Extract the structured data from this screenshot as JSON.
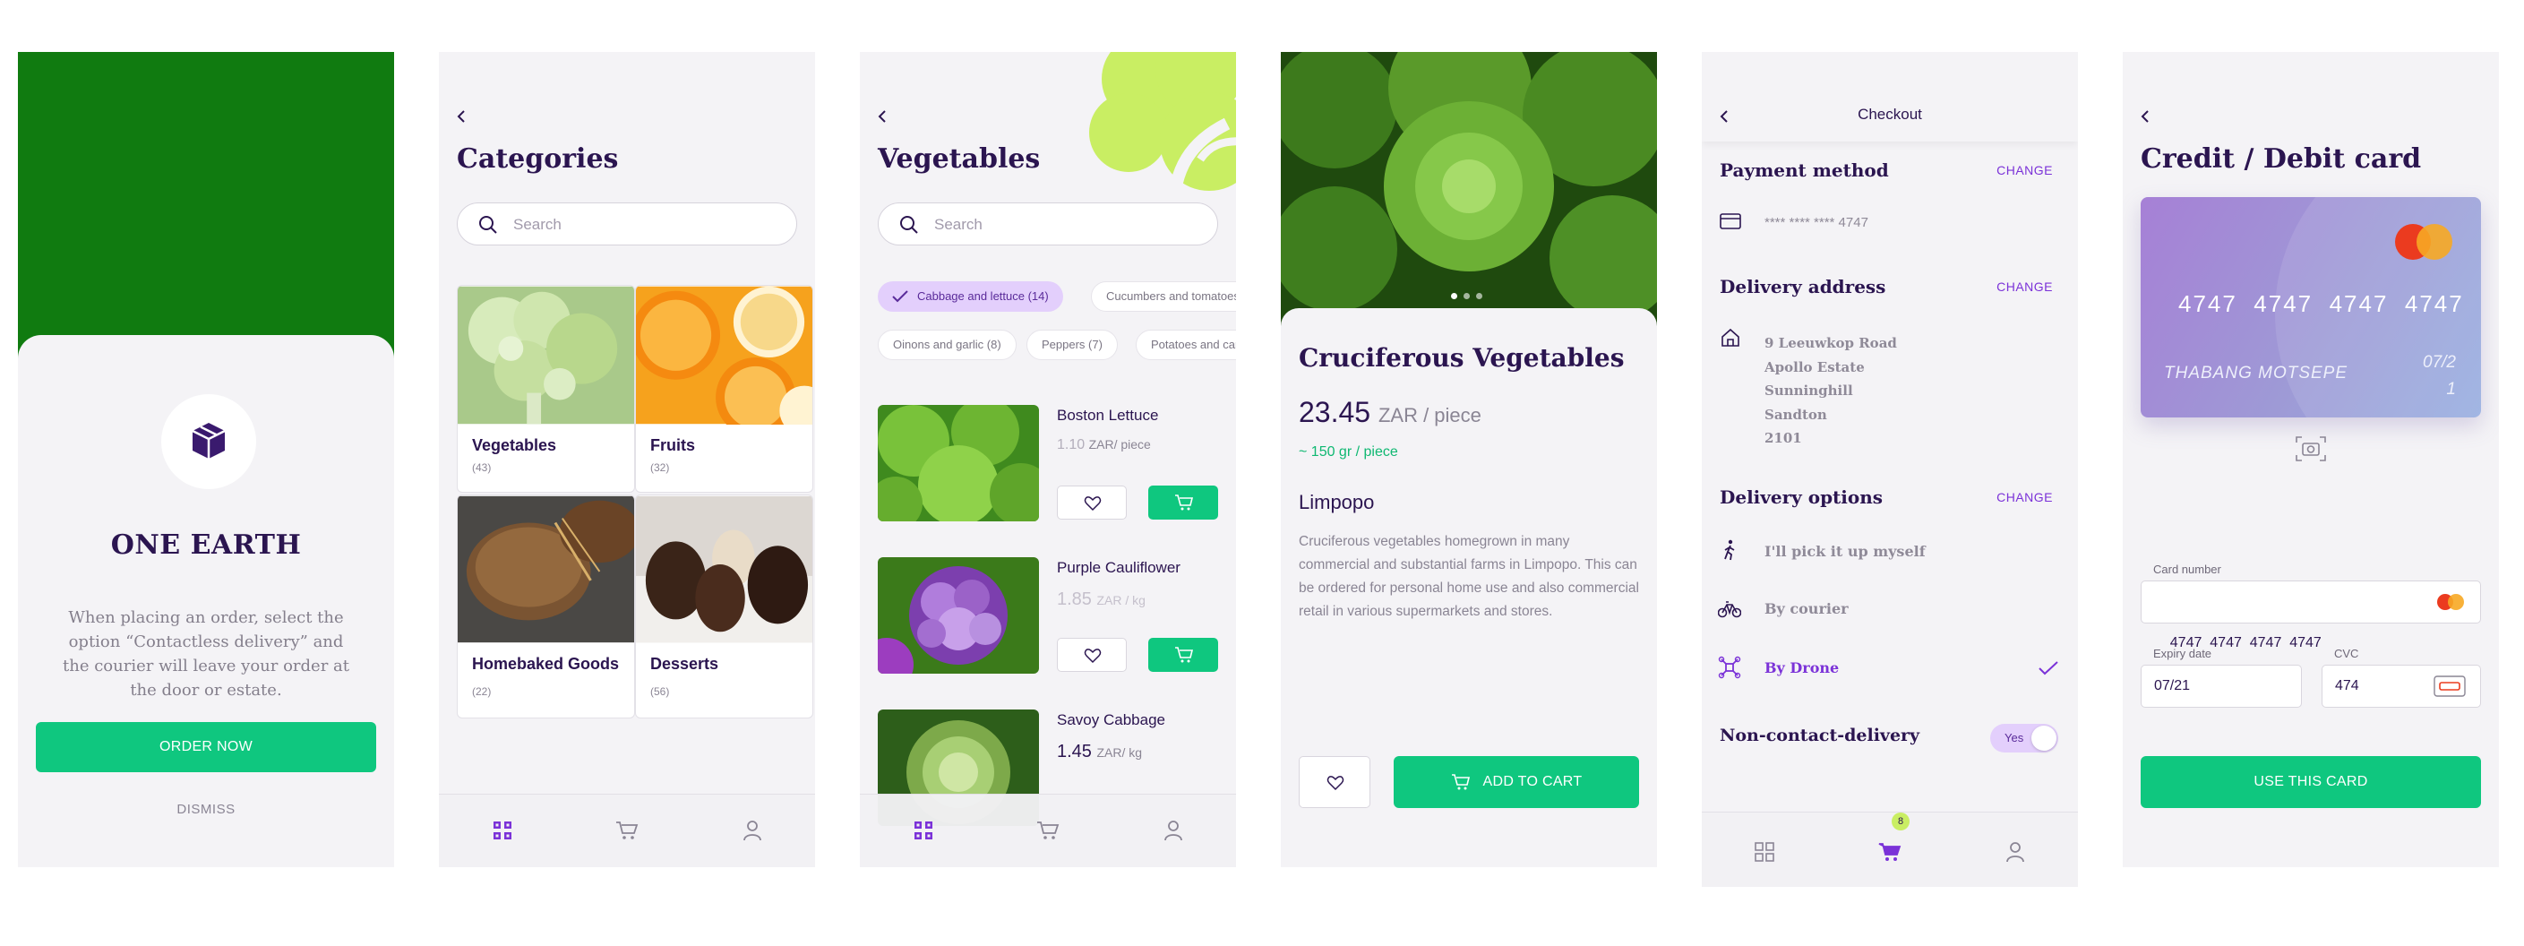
{
  "s1": {
    "brand": "ONE EARTH",
    "message": "When placing an order, select the option “Contactless delivery” and the courier will leave your order at the door or estate.",
    "order_btn": "ORDER NOW",
    "dismiss": "DISMISS"
  },
  "s2": {
    "title": "Categories",
    "search_placeholder": "Search",
    "categories": [
      {
        "name": "Vegetables",
        "count": "(43)"
      },
      {
        "name": "Fruits",
        "count": "(32)"
      },
      {
        "name": "Homebaked Goods",
        "count": "(22)"
      },
      {
        "name": "Desserts",
        "count": "(56)"
      }
    ]
  },
  "s3": {
    "title": "Vegetables",
    "search_placeholder": "Search",
    "chips": [
      "Cabbage and lettuce (14)",
      "Cucumbers and tomatoes",
      "Oinons and garlic (8)",
      "Peppers (7)",
      "Potatoes and carr"
    ],
    "products": [
      {
        "name": "Boston Lettuce",
        "price": "1.10",
        "unit": "ZAR/ piece"
      },
      {
        "name": "Purple Cauliflower",
        "price": "1.85",
        "unit": "ZAR / kg"
      },
      {
        "name": "Savoy Cabbage",
        "price": "1.45",
        "unit": "ZAR/ kg"
      }
    ]
  },
  "s4": {
    "title": "Cruciferous Vegetables",
    "price": "23.45",
    "unit": "ZAR / piece",
    "weight": "~ 150 gr / piece",
    "origin": "Limpopo",
    "description": "Cruciferous vegetables homegrown in many commercial and substantial farms in Limpopo. This can be ordered for personal home use and also commercial retail in various supermarkets and stores.",
    "add_btn": "ADD TO CART"
  },
  "s5": {
    "header": "Checkout",
    "payment_title": "Payment method",
    "change": "CHANGE",
    "card_masked": "**** **** **** 4747",
    "address_title": "Delivery address",
    "address_lines": [
      "9 Leeuwkop Road",
      "Apollo Estate",
      "Sunninghill",
      "Sandton",
      "2101"
    ],
    "options_title": "Delivery options",
    "options": [
      "I'll pick it up myself",
      "By courier",
      "By Drone"
    ],
    "noncontact_label": "Non-contact-delivery",
    "toggle_label": "Yes",
    "cart_badge": "8"
  },
  "s6": {
    "title": "Credit / Debit card",
    "card_number_display": "4747  4747  4747  4747",
    "card_holder": "THABANG MOTSEPE",
    "card_expiry": "07/2",
    "card_expiry_2": "1",
    "card_number_label": "Card number",
    "card_number_value": "4747  4747  4747  4747",
    "expiry_label": "Expiry date",
    "expiry_value": "07/21",
    "cvc_label": "CVC",
    "cvc_value": "474",
    "use_btn": "USE THIS CARD"
  },
  "colors": {
    "brand_green": "#0fc77f",
    "accent_purple": "#7b32d8",
    "heading": "#2b1550",
    "splash_green": "#107b10"
  }
}
